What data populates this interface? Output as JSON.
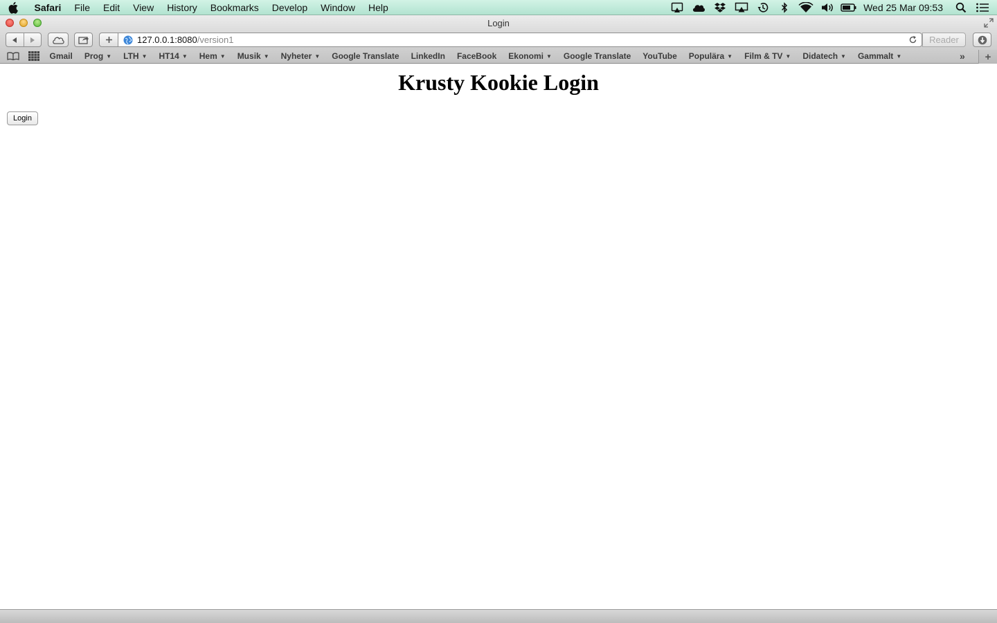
{
  "menubar": {
    "apple_icon": "apple-logo-icon",
    "app_name": "Safari",
    "items": [
      "File",
      "Edit",
      "View",
      "History",
      "Bookmarks",
      "Develop",
      "Window",
      "Help"
    ],
    "status_icons": [
      "airplay-display-icon",
      "cloud-icon",
      "dropbox-icon",
      "airplay-icon",
      "time-machine-icon",
      "bluetooth-icon",
      "wifi-icon",
      "volume-icon",
      "battery-icon"
    ],
    "clock": "Wed 25 Mar  09:53"
  },
  "window": {
    "title": "Login"
  },
  "toolbar": {
    "url_host": "127.0.0.1:8080",
    "url_path": "/version1",
    "reader_label": "Reader"
  },
  "bookmarks_bar": {
    "items": [
      {
        "label": "Gmail",
        "folder": false
      },
      {
        "label": "Prog",
        "folder": true
      },
      {
        "label": "LTH",
        "folder": true
      },
      {
        "label": "HT14",
        "folder": true
      },
      {
        "label": "Hem",
        "folder": true
      },
      {
        "label": "Musik",
        "folder": true
      },
      {
        "label": "Nyheter",
        "folder": true
      },
      {
        "label": "Google Translate",
        "folder": false
      },
      {
        "label": "LinkedIn",
        "folder": false
      },
      {
        "label": "FaceBook",
        "folder": false
      },
      {
        "label": "Ekonomi",
        "folder": true
      },
      {
        "label": "Google Translate",
        "folder": false
      },
      {
        "label": "YouTube",
        "folder": false
      },
      {
        "label": "Populära",
        "folder": true
      },
      {
        "label": "Film & TV",
        "folder": true
      },
      {
        "label": "Didatech",
        "folder": true
      },
      {
        "label": "Gammalt",
        "folder": true
      }
    ]
  },
  "page": {
    "heading": "Krusty Kookie Login",
    "login_button": "Login"
  },
  "colors": {
    "menubar": "#c4ecdc",
    "chrome": "#d6d6d6",
    "page_background": "#ffffff"
  }
}
